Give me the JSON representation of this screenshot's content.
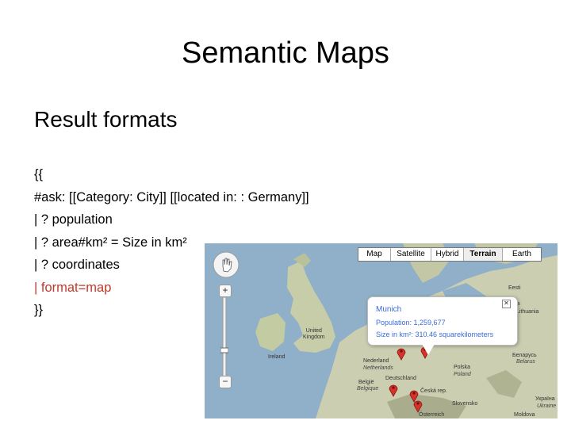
{
  "slide": {
    "title": "Semantic Maps",
    "subtitle": "Result formats",
    "code_lines": [
      "{{",
      "#ask: [[Category: City]] [[located in: : Germany]]",
      "| ? population",
      "| ? area#km² = Size in km²",
      "| ? coordinates",
      "| format=map",
      "}}"
    ],
    "highlight_color": "#c0392b"
  },
  "map": {
    "map_types": [
      "Map",
      "Satellite",
      "Hybrid",
      "Terrain",
      "Earth"
    ],
    "active_map_type": "Terrain",
    "zoom_in_label": "+",
    "zoom_out_label": "−",
    "labels": {
      "united_kingdom": "United\nKingdom",
      "ireland": "Ireland",
      "nederland": "Nederland",
      "netherlands": "Netherlands",
      "belgie": "België",
      "belgique": "Belgique",
      "deutschland": "Deutschland",
      "polska": "Polska",
      "poland": "Poland",
      "ceska": "Česká rep.",
      "slovensko": "Slovensko",
      "osterreich": "Österreich",
      "eesti": "Eesti",
      "lv": "ia",
      "belarus_cyr": "Беларусь",
      "belarus": "Belarus",
      "ukraine_cyr": "Україна",
      "ukraine": "Ukraine",
      "moldova": "Moldova",
      "lithuania": "Lithuania"
    },
    "popup": {
      "city": "Munich",
      "population": "Population: 1,259,677",
      "size": "Size in km²: 310.46 squarekilometers",
      "close": "✕"
    },
    "colors": {
      "water": "#8fb0c8",
      "land": "#c9cfb0",
      "popup_text": "#3b6bd6",
      "marker": "#d6322b"
    }
  }
}
